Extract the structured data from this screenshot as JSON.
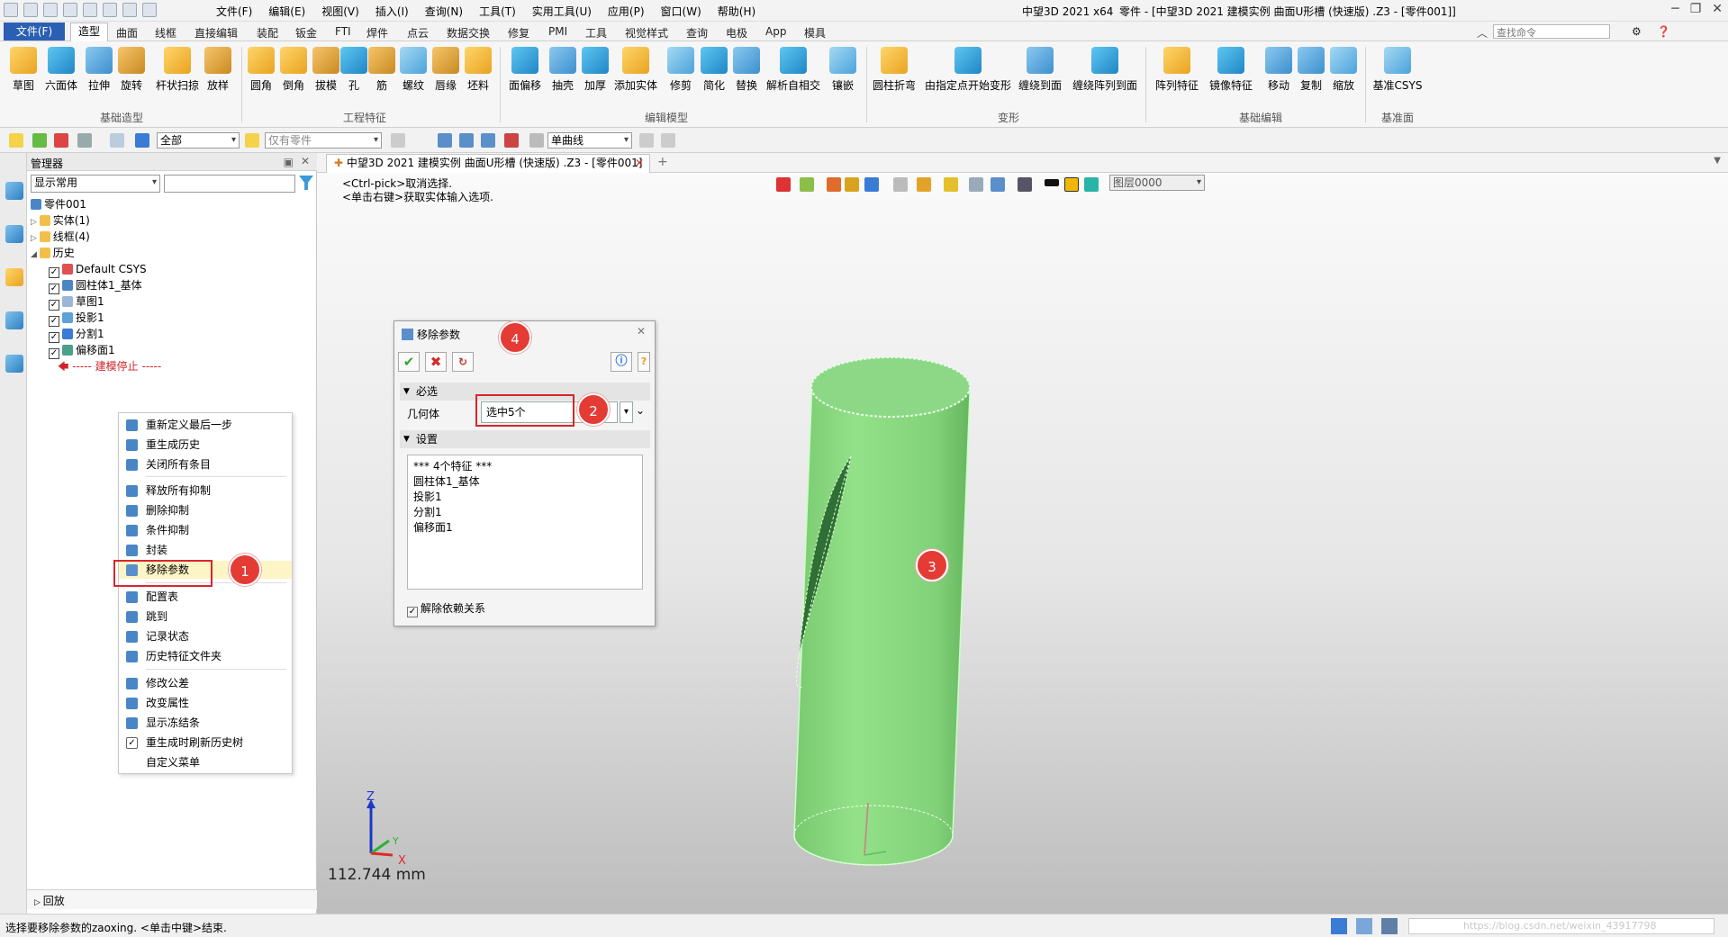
{
  "window": {
    "app": "中望3D 2021 x64",
    "doc_title": "零件 - [中望3D 2021 建模实例 曲面U形槽 (快速版) .Z3 - [零件001]]"
  },
  "menubar": {
    "items": [
      "文件(F)",
      "编辑(E)",
      "视图(V)",
      "插入(I)",
      "查询(N)",
      "工具(T)",
      "实用工具(U)",
      "应用(P)",
      "窗口(W)",
      "帮助(H)"
    ]
  },
  "ribbon_tabs": {
    "file": "文件(F)",
    "active": "造型",
    "items": [
      "曲面",
      "线框",
      "直接编辑",
      "装配",
      "钣金",
      "FTI",
      "焊件",
      "点云",
      "数据交换",
      "修复",
      "PMI",
      "工具",
      "视觉样式",
      "查询",
      "电极",
      "App",
      "模具"
    ]
  },
  "search": {
    "placeholder": "查找命令"
  },
  "ribbon": {
    "buttons": [
      "草图",
      "六面体",
      "拉伸",
      "旋转",
      "杆状扫掠",
      "放样",
      "圆角",
      "倒角",
      "拔模",
      "孔",
      "筋",
      "螺纹",
      "唇缘",
      "坯料",
      "面偏移",
      "抽壳",
      "加厚",
      "添加实体",
      "修剪",
      "简化",
      "替换",
      "解析自相交",
      "镶嵌",
      "圆柱折弯",
      "由指定点开始变形",
      "缠绕到面",
      "缠绕阵列到面",
      "阵列特征",
      "镜像特征",
      "移动",
      "复制",
      "缩放",
      "基准CSYS"
    ],
    "groups": [
      "基础造型",
      "工程特征",
      "编辑模型",
      "变形",
      "基础编辑",
      "基准面"
    ]
  },
  "toolbar2": {
    "filter": "全部",
    "parts_placeholder": "仅有零件",
    "curve": "单曲线"
  },
  "manager": {
    "title": "管理器",
    "display": "显示常用",
    "tree": {
      "root": "零件001",
      "solid": "实体(1)",
      "wire": "线框(4)",
      "history": "历史",
      "items": [
        "Default CSYS",
        "圆柱体1_基体",
        "草图1",
        "投影1",
        "分割1",
        "偏移面1"
      ],
      "stop": "----- 建模停止 -----"
    },
    "bottom": "回放"
  },
  "context_menu": {
    "items": [
      "重新定义最后一步",
      "重生成历史",
      "关闭所有条目",
      "释放所有抑制",
      "删除抑制",
      "条件抑制",
      "封装",
      "移除参数",
      "配置表",
      "跳到",
      "记录状态",
      "历史特征文件夹",
      "修改公差",
      "改变属性",
      "显示冻结条",
      "重生成时刷新历史树",
      "自定义菜单"
    ]
  },
  "document": {
    "tab": "中望3D 2021 建模实例 曲面U形槽 (快速版) .Z3 - [零件001]",
    "hint1": "<Ctrl-pick>取消选择.",
    "hint2": "<单击右键>获取实体输入选项.",
    "layer": "图层0000",
    "measure": "112.744 mm"
  },
  "dialog": {
    "title": "移除参数",
    "required": "必选",
    "geometry_label": "几何体",
    "geometry_value": "选中5个",
    "settings": "设置",
    "list": [
      "*** 4个特征 ***",
      "圆柱体1_基体",
      "投影1",
      "分割1",
      "偏移面1"
    ],
    "checkbox": "解除依赖关系"
  },
  "badges": {
    "b1": "1",
    "b2": "2",
    "b3": "3",
    "b4": "4"
  },
  "axes": {
    "z": "Z",
    "y": "Y",
    "x": "X"
  },
  "status": {
    "message": "选择要移除参数的zaoxing. <单击中键>结束.",
    "watermark": "https://blog.csdn.net/weixin_43917798"
  },
  "colors": {
    "accent": "#2b5fb3",
    "badge": "#e53b35",
    "model": "#86d884"
  }
}
